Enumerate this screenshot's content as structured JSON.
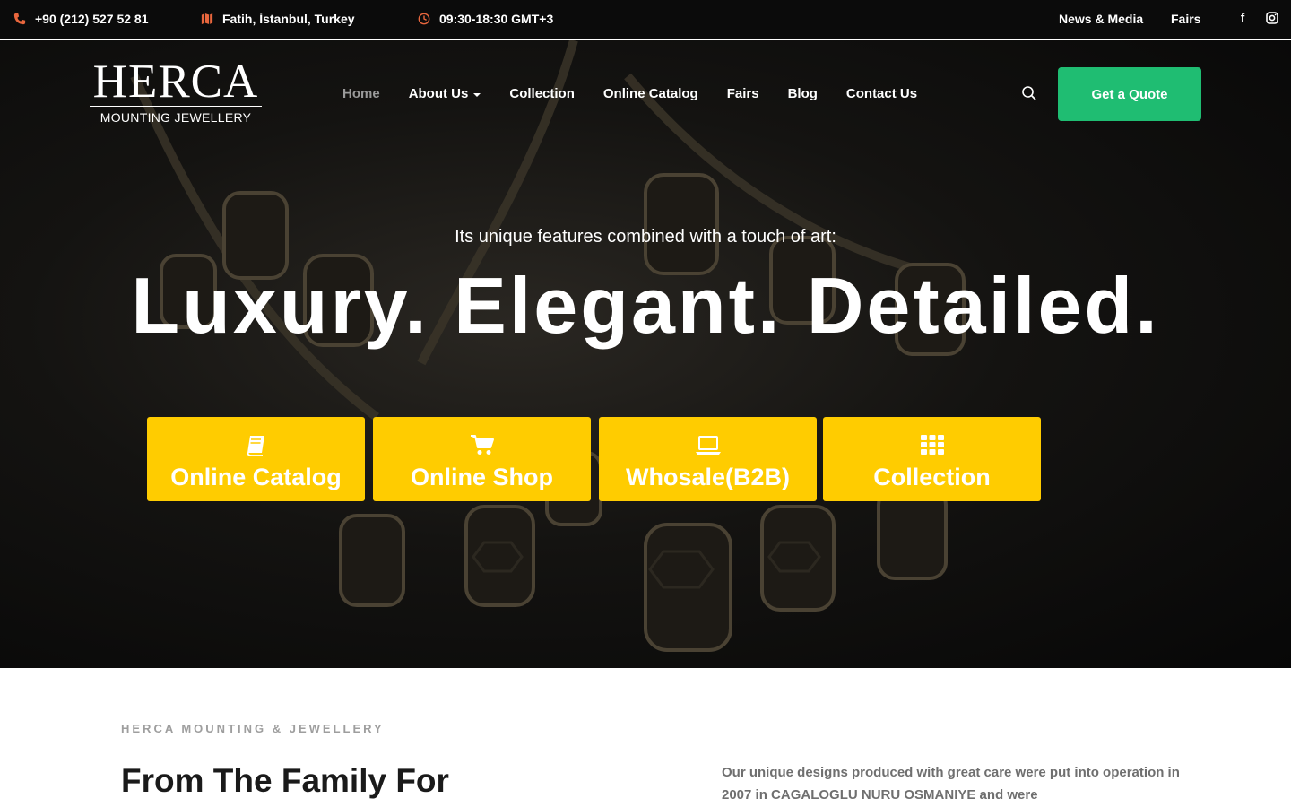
{
  "topbar": {
    "phone": "+90 (212) 527 52 81",
    "location": "Fatih, İstanbul, Turkey",
    "hours": "09:30-18:30 GMT+3",
    "links": [
      "News & Media",
      "Fairs"
    ],
    "social": [
      {
        "name": "facebook-icon",
        "glyph": "f"
      },
      {
        "name": "instagram-icon",
        "glyph": "◙"
      }
    ],
    "icon_color": "#e8663d"
  },
  "logo": {
    "word": "HERCA",
    "sub": "MOUNTING JEWELLERY"
  },
  "nav": {
    "items": [
      "Home",
      "About Us",
      "Collection",
      "Online Catalog",
      "Fairs",
      "Blog",
      "Contact Us"
    ],
    "active": "Home",
    "cta_label": "Get a Quote",
    "cta_color": "#1fbd72"
  },
  "hero": {
    "tagline": "Its unique features combined with a touch of art:",
    "headline": "Luxury. Elegant. Detailed.",
    "buttons": [
      {
        "label": "Online Catalog",
        "icon": "book-icon"
      },
      {
        "label": "Online Shop",
        "icon": "cart-icon"
      },
      {
        "label": "Whosale(B2B)",
        "icon": "laptop-icon"
      },
      {
        "label": "Collection",
        "icon": "grid-icon"
      }
    ],
    "button_color": "#ffcc00"
  },
  "about": {
    "eyebrow": "HERCA MOUNTING & JEWELLERY",
    "title": "From The Family For",
    "body": "Our unique designs produced with great care were put into operation in 2007 in CAGALOGLU NURU OSMANIYE and were"
  }
}
